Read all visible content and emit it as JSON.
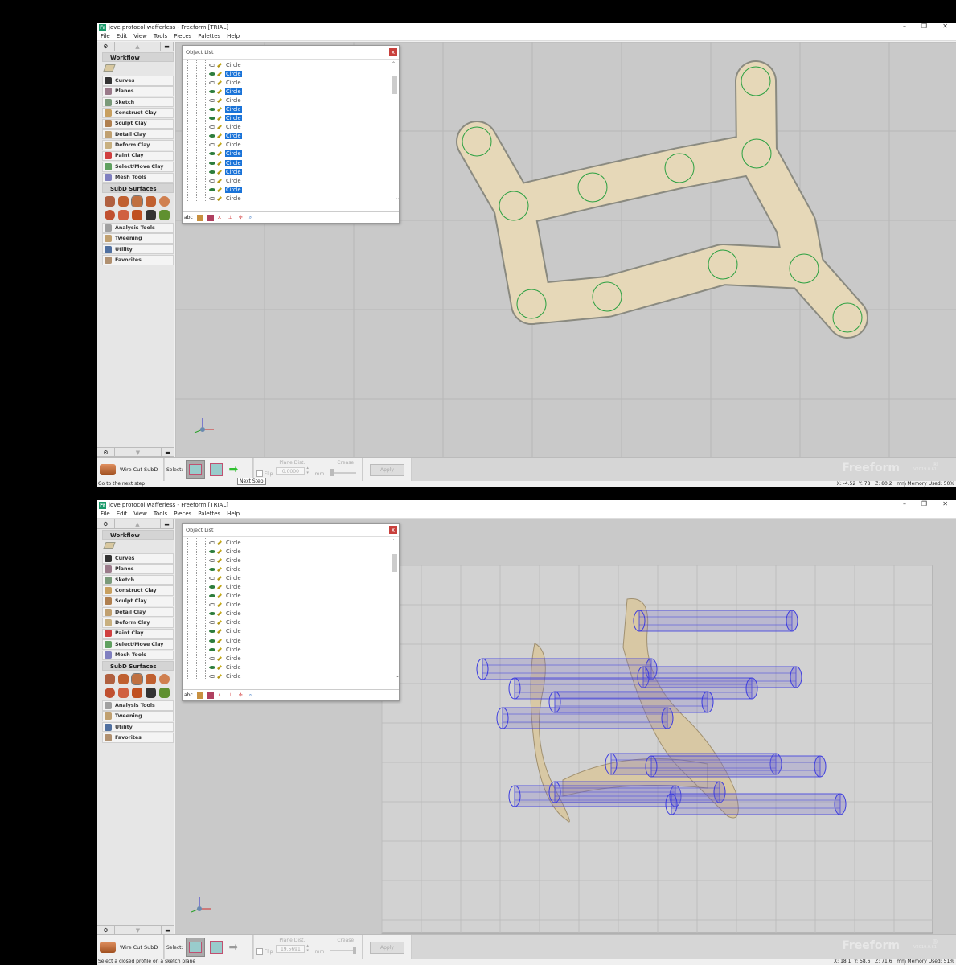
{
  "panels": [
    {
      "title": "jove protocol wafferless - Freeform [TRIAL]",
      "menu": [
        "File",
        "Edit",
        "View",
        "Tools",
        "Pieces",
        "Palettes",
        "Help"
      ],
      "sidebar": {
        "workflow": "Workflow",
        "items": [
          "Curves",
          "Planes",
          "Sketch",
          "Construct Clay",
          "Sculpt Clay",
          "Detail Clay",
          "Deform Clay",
          "Paint Clay",
          "Select/Move Clay",
          "Mesh Tools"
        ],
        "subd": "SubD Surfaces",
        "items2": [
          "Analysis Tools",
          "Tweening",
          "Utility",
          "Favorites"
        ]
      },
      "object_list": {
        "title": "Object List",
        "close": "x",
        "rows": [
          {
            "label": "Circle",
            "visible": false,
            "selected": false
          },
          {
            "label": "Circle",
            "visible": true,
            "selected": true
          },
          {
            "label": "Circle",
            "visible": false,
            "selected": false
          },
          {
            "label": "Circle",
            "visible": true,
            "selected": true
          },
          {
            "label": "Circle",
            "visible": false,
            "selected": false
          },
          {
            "label": "Circle",
            "visible": true,
            "selected": true
          },
          {
            "label": "Circle",
            "visible": true,
            "selected": true
          },
          {
            "label": "Circle",
            "visible": false,
            "selected": false
          },
          {
            "label": "Circle",
            "visible": true,
            "selected": true
          },
          {
            "label": "Circle",
            "visible": false,
            "selected": false
          },
          {
            "label": "Circle",
            "visible": true,
            "selected": true
          },
          {
            "label": "Circle",
            "visible": true,
            "selected": true
          },
          {
            "label": "Circle",
            "visible": true,
            "selected": true
          },
          {
            "label": "Circle",
            "visible": false,
            "selected": false
          },
          {
            "label": "Circle",
            "visible": true,
            "selected": true
          },
          {
            "label": "Circle",
            "visible": false,
            "selected": false
          },
          {
            "label": "Circle",
            "visible": true,
            "selected": true
          }
        ],
        "toolbar_text": "abc"
      },
      "tool": {
        "name": "Wire Cut SubD",
        "select_label": "Select:",
        "next_active": true,
        "flip": "Flip",
        "plane_dist_label": "Plane Dist.",
        "plane_dist": "0.0000",
        "unit": "mm",
        "crease": "Crease",
        "crease_level": 0,
        "apply": "Apply"
      },
      "tooltip": "Next Step",
      "brand": "Freeform",
      "version": "V2019.0.61",
      "status": "Go to the next step",
      "coords": {
        "x": "-4.52",
        "y": "78",
        "z": "80.2",
        "unit": "mm"
      },
      "memory": "Memory Used: 50%",
      "view": "top"
    },
    {
      "title": "jove protocol wafferless - Freeform [TRIAL]",
      "menu": [
        "File",
        "Edit",
        "View",
        "Tools",
        "Pieces",
        "Palettes",
        "Help"
      ],
      "sidebar": {
        "workflow": "Workflow",
        "items": [
          "Curves",
          "Planes",
          "Sketch",
          "Construct Clay",
          "Sculpt Clay",
          "Detail Clay",
          "Deform Clay",
          "Paint Clay",
          "Select/Move Clay",
          "Mesh Tools"
        ],
        "subd": "SubD Surfaces",
        "items2": [
          "Analysis Tools",
          "Tweening",
          "Utility",
          "Favorites"
        ]
      },
      "object_list": {
        "title": "Object List",
        "close": "x",
        "rows": [
          {
            "label": "Circle",
            "visible": false,
            "selected": false
          },
          {
            "label": "Circle",
            "visible": true,
            "selected": false
          },
          {
            "label": "Circle",
            "visible": false,
            "selected": false
          },
          {
            "label": "Circle",
            "visible": true,
            "selected": false
          },
          {
            "label": "Circle",
            "visible": false,
            "selected": false
          },
          {
            "label": "Circle",
            "visible": true,
            "selected": false
          },
          {
            "label": "Circle",
            "visible": true,
            "selected": false
          },
          {
            "label": "Circle",
            "visible": false,
            "selected": false
          },
          {
            "label": "Circle",
            "visible": true,
            "selected": false
          },
          {
            "label": "Circle",
            "visible": false,
            "selected": false
          },
          {
            "label": "Circle",
            "visible": true,
            "selected": false
          },
          {
            "label": "Circle",
            "visible": true,
            "selected": false
          },
          {
            "label": "Circle",
            "visible": true,
            "selected": false
          },
          {
            "label": "Circle",
            "visible": false,
            "selected": false
          },
          {
            "label": "Circle",
            "visible": true,
            "selected": false
          },
          {
            "label": "Circle",
            "visible": false,
            "selected": false
          },
          {
            "label": "Circle",
            "visible": true,
            "selected": false
          }
        ],
        "toolbar_text": "abc"
      },
      "tool": {
        "name": "Wire Cut SubD",
        "select_label": "Select:",
        "next_active": false,
        "flip": "Flip",
        "plane_dist_label": "Plane Dist.",
        "plane_dist": "19.5691",
        "unit": "mm",
        "crease": "Crease",
        "crease_level": 1,
        "apply": "Apply"
      },
      "tooltip": "",
      "brand": "Freeform",
      "version": "V2019.0.61",
      "status": "Select a closed profile on a sketch plane",
      "coords": {
        "x": "18.1",
        "y": "58.6",
        "z": "71.6",
        "unit": "mm"
      },
      "memory": "Memory Used: 51%",
      "view": "perspective"
    }
  ],
  "colors": {
    "selection": "#1a73d8",
    "model": "#e6d8b8",
    "cylinder": "#3a3ae0",
    "circle": "#2aa040",
    "viewport": "#c9c9c9"
  }
}
